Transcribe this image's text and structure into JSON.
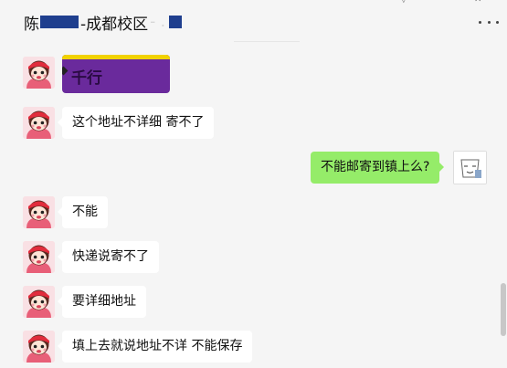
{
  "header": {
    "title_prefix": "陈",
    "title_main": "-成都校区",
    "title_faint": "- ."
  },
  "messages": [
    {
      "side": "left",
      "type": "sticker",
      "text": "千行",
      "icon": "avatar-cartoon-girl"
    },
    {
      "side": "left",
      "type": "text",
      "text": "这个地址不详细 寄不了",
      "icon": "avatar-cartoon-girl"
    },
    {
      "side": "right",
      "type": "text",
      "text": "不能邮寄到镇上么?",
      "icon": "avatar-sticker-figure"
    },
    {
      "side": "left",
      "type": "text",
      "text": "不能",
      "icon": "avatar-cartoon-girl"
    },
    {
      "side": "left",
      "type": "text",
      "text": "快递说寄不了",
      "icon": "avatar-cartoon-girl"
    },
    {
      "side": "left",
      "type": "text",
      "text": "要详细地址",
      "icon": "avatar-cartoon-girl"
    },
    {
      "side": "left",
      "type": "text",
      "text": "填上去就说地址不详 不能保存",
      "icon": "avatar-cartoon-girl"
    }
  ],
  "colors": {
    "background": "#f5f5f5",
    "sent_bubble": "#95ec69",
    "received_bubble": "#ffffff",
    "redaction": "#1f3f8e",
    "sticker_purple": "#6a2a9c"
  }
}
